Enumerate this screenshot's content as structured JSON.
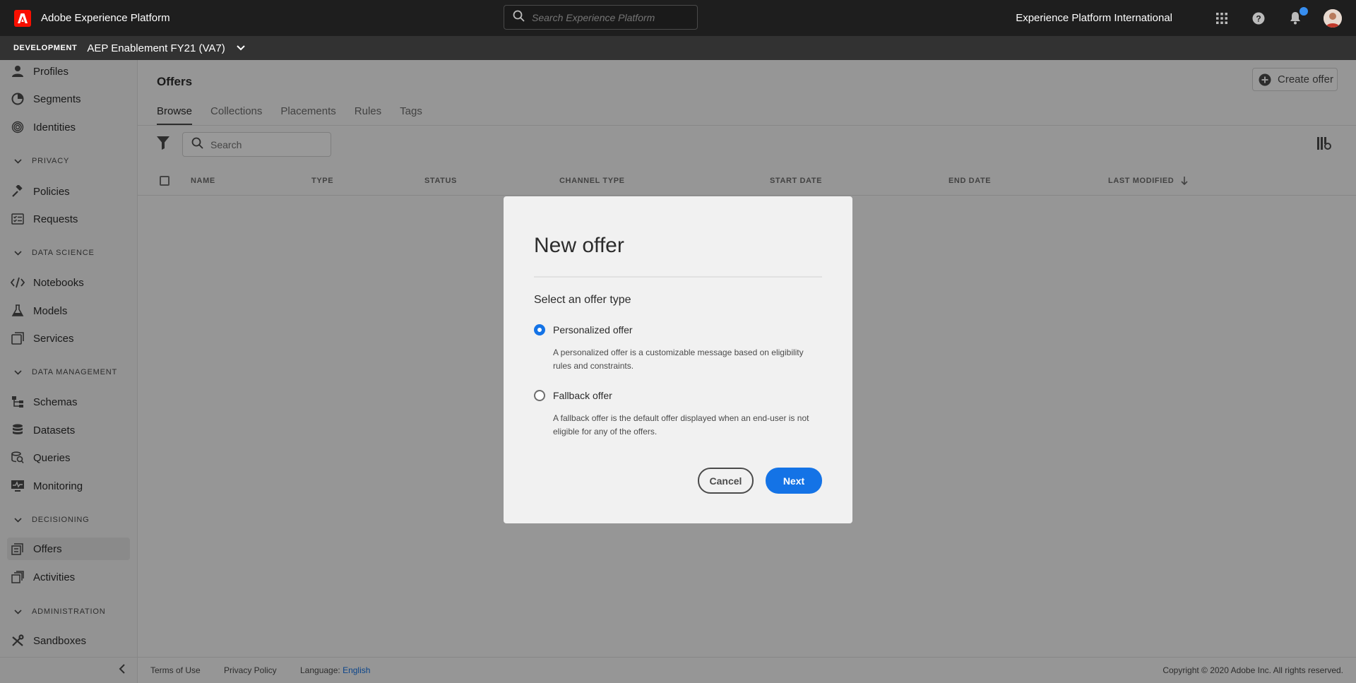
{
  "app": {
    "title": "Adobe Experience Platform",
    "search_placeholder": "Search Experience Platform",
    "org_name": "Experience Platform International",
    "icons": [
      "apps-grid-icon",
      "help-icon",
      "bell-icon",
      "avatar"
    ],
    "notification_dot_color": "#378ef0",
    "brand_color": "#fa0f00"
  },
  "sandbox": {
    "badge": "DEVELOPMENT",
    "name": "AEP Enablement FY21 (VA7)"
  },
  "sidebar": {
    "items": [
      {
        "label": "Profiles",
        "icon": "profile-icon"
      },
      {
        "label": "Segments",
        "icon": "segments-icon"
      },
      {
        "label": "Identities",
        "icon": "fingerprint-icon"
      },
      {
        "label": "Policies",
        "icon": "gavel-icon"
      },
      {
        "label": "Requests",
        "icon": "checklist-icon"
      },
      {
        "label": "Notebooks",
        "icon": "code-icon"
      },
      {
        "label": "Models",
        "icon": "beaker-icon"
      },
      {
        "label": "Services",
        "icon": "services-icon"
      },
      {
        "label": "Schemas",
        "icon": "schema-icon"
      },
      {
        "label": "Datasets",
        "icon": "database-icon"
      },
      {
        "label": "Queries",
        "icon": "query-icon"
      },
      {
        "label": "Monitoring",
        "icon": "monitor-icon"
      },
      {
        "label": "Offers",
        "icon": "offers-icon",
        "active": true
      },
      {
        "label": "Activities",
        "icon": "activities-icon"
      },
      {
        "label": "Sandboxes",
        "icon": "tools-icon"
      }
    ],
    "sections": {
      "privacy": "PRIVACY",
      "data_science": "DATA SCIENCE",
      "data_management": "DATA MANAGEMENT",
      "decisioning": "DECISIONING",
      "administration": "ADMINISTRATION"
    }
  },
  "main": {
    "title": "Offers",
    "create_label": "Create offer",
    "tabs": [
      "Browse",
      "Collections",
      "Placements",
      "Rules",
      "Tags"
    ],
    "active_tab": "Browse",
    "search_placeholder": "Search",
    "columns": [
      "NAME",
      "TYPE",
      "STATUS",
      "CHANNEL TYPE",
      "START DATE",
      "END DATE",
      "LAST MODIFIED"
    ],
    "sort_column": "LAST MODIFIED",
    "sort_direction": "descending"
  },
  "footer": {
    "terms": "Terms of Use",
    "privacy": "Privacy Policy",
    "language_label": "Language:",
    "language_value": "English",
    "copyright": "Copyright ©  2020 Adobe Inc.  All rights reserved."
  },
  "dialog": {
    "title": "New offer",
    "subtitle": "Select an offer type",
    "options": [
      {
        "label": "Personalized offer",
        "desc": "A personalized offer is a customizable message based on eligibility rules and constraints.",
        "selected": true
      },
      {
        "label": "Fallback offer",
        "desc": "A fallback offer is the default offer displayed when an end-user is not eligible for any of the offers.",
        "selected": false
      }
    ],
    "cancel_label": "Cancel",
    "next_label": "Next",
    "accent_color": "#1473e6"
  }
}
